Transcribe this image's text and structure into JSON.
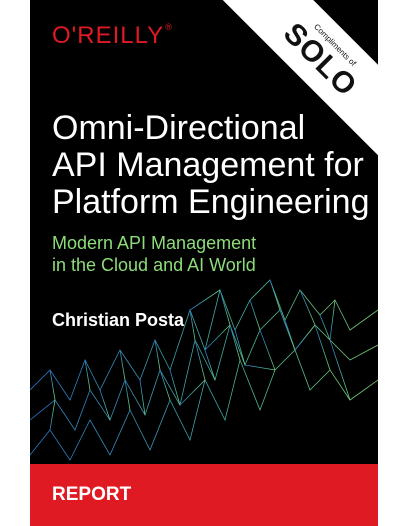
{
  "publisher": {
    "name": "O'REILLY",
    "registered": "®"
  },
  "banner": {
    "small_text": "Compliments of",
    "logo_text": "SOLO"
  },
  "title_lines": [
    "Omni-Directional",
    "API Management for",
    "Platform Engineering"
  ],
  "subtitle_lines": [
    "Modern API Management",
    "in the Cloud and AI World"
  ],
  "author": "Christian Posta",
  "footer": {
    "label": "REPORT"
  },
  "colors": {
    "accent_red": "#e01a22",
    "subtitle_green": "#8ddc7a",
    "mesh_blue": "#2f7fd6",
    "mesh_green": "#7fd87a"
  }
}
